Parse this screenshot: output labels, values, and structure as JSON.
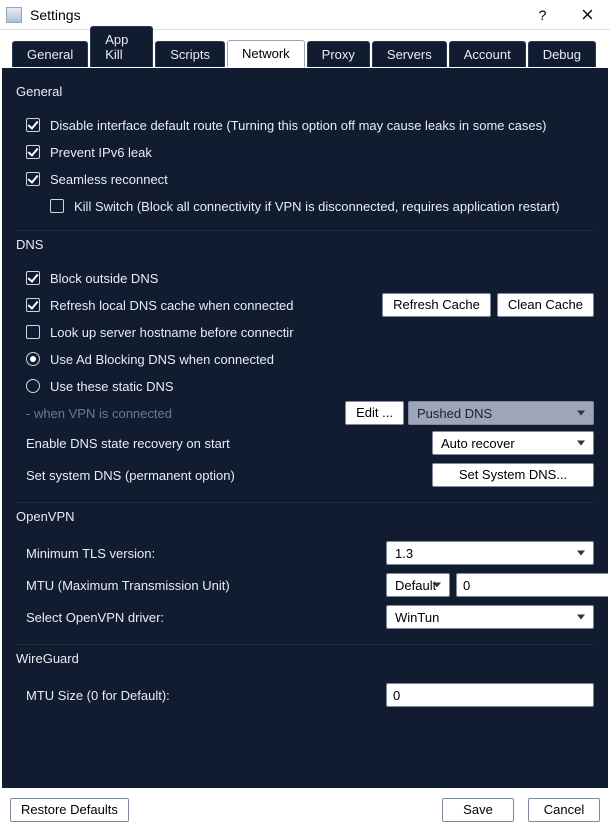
{
  "window": {
    "title": "Settings"
  },
  "tabs": {
    "items": [
      {
        "label": "General"
      },
      {
        "label": "App Kill"
      },
      {
        "label": "Scripts"
      },
      {
        "label": "Network"
      },
      {
        "label": "Proxy"
      },
      {
        "label": "Servers"
      },
      {
        "label": "Account"
      },
      {
        "label": "Debug"
      }
    ],
    "active_index": 3
  },
  "sections": {
    "general": {
      "title": "General",
      "disable_route": {
        "label": "Disable interface default route (Turning this option off may cause leaks in some cases)",
        "checked": true
      },
      "prevent_ipv6": {
        "label": "Prevent IPv6 leak",
        "checked": true
      },
      "seamless": {
        "label": "Seamless reconnect",
        "checked": true
      },
      "kill_switch": {
        "label": "Kill Switch (Block all connectivity if VPN is disconnected, requires application restart)",
        "checked": false
      }
    },
    "dns": {
      "title": "DNS",
      "block_outside": {
        "label": "Block outside DNS",
        "checked": true
      },
      "refresh_local": {
        "label": "Refresh local DNS cache when connected",
        "checked": true
      },
      "refresh_btn": "Refresh Cache",
      "clean_btn": "Clean Cache",
      "lookup_host": {
        "label": "Look up server hostname before connectir",
        "checked": false
      },
      "use_adblock": {
        "label": "Use Ad Blocking DNS when connected",
        "selected": true
      },
      "use_static": {
        "label": "Use these static DNS",
        "selected": false
      },
      "when_vpn": " - when VPN is connected",
      "edit_btn": "Edit ...",
      "pushed_select": "Pushed DNS",
      "enable_recovery_label": "Enable DNS state recovery on start",
      "recovery_select": "Auto recover",
      "set_sys_label": "Set system DNS (permanent option)",
      "set_sys_btn": "Set System DNS..."
    },
    "openvpn": {
      "title": "OpenVPN",
      "min_tls_label": "Minimum TLS version:",
      "min_tls_value": "1.3",
      "mtu_label": "MTU (Maximum Transmission Unit)",
      "mtu_mode": "Default",
      "mtu_value": "0",
      "driver_label": "Select OpenVPN driver:",
      "driver_value": "WinTun"
    },
    "wireguard": {
      "title": "WireGuard",
      "mtu_label": "MTU Size (0 for Default):",
      "mtu_value": "0"
    }
  },
  "footer": {
    "restore": "Restore Defaults",
    "save": "Save",
    "cancel": "Cancel"
  }
}
